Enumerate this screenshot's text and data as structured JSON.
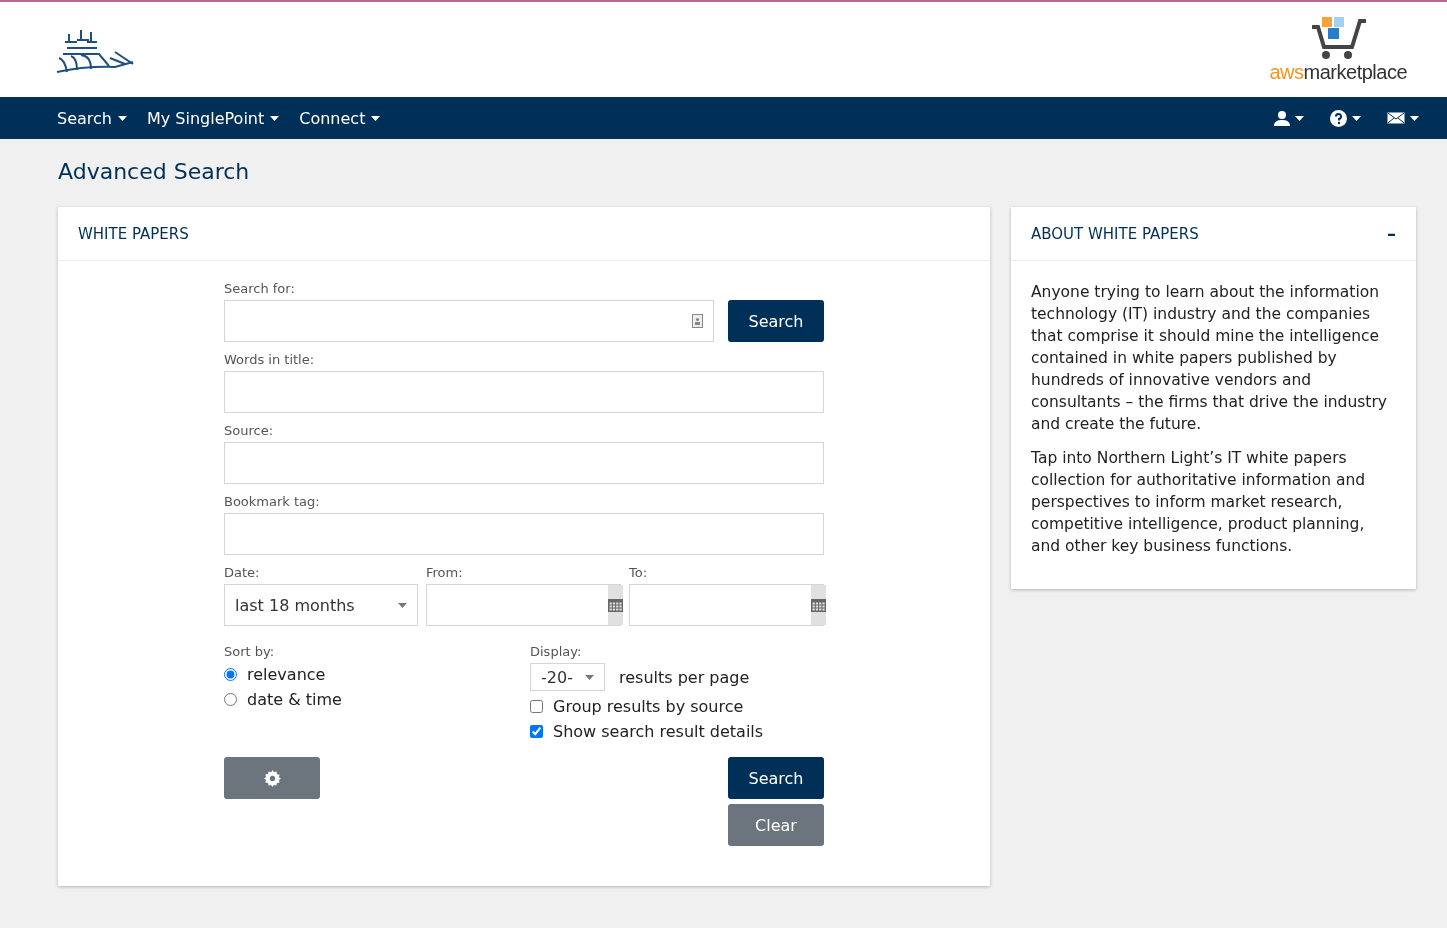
{
  "header": {
    "aws_logo": {
      "prefix": "aws",
      "suffix": "marketplace"
    }
  },
  "nav": {
    "items": [
      {
        "label": "Search"
      },
      {
        "label": "My SinglePoint"
      },
      {
        "label": "Connect"
      }
    ]
  },
  "page_title": "Advanced Search",
  "form_panel": {
    "title": "WHITE PAPERS",
    "search_for": {
      "label": "Search for:",
      "button": "Search"
    },
    "fields": [
      {
        "label": "Words in title:"
      },
      {
        "label": "Source:"
      },
      {
        "label": "Bookmark tag:"
      }
    ],
    "date": {
      "label": "Date:",
      "value": "last 18 months"
    },
    "from": {
      "label": "From:"
    },
    "to": {
      "label": "To:"
    },
    "sort": {
      "label": "Sort by:",
      "options": [
        {
          "label": "relevance",
          "selected": true
        },
        {
          "label": "date & time",
          "selected": false
        }
      ]
    },
    "display": {
      "label": "Display:",
      "value": "-20-",
      "suffix": "results per page"
    },
    "checks": [
      {
        "label": "Group results by source",
        "checked": false
      },
      {
        "label": "Show search result details",
        "checked": true
      }
    ],
    "search_button": "Search",
    "clear_button": "Clear"
  },
  "about_panel": {
    "title": "ABOUT WHITE PAPERS",
    "collapse": "–",
    "paragraphs": [
      "Anyone trying to learn about the information technology (IT) industry and the companies that comprise it should mine the intelligence contained in white papers published by hundreds of innovative vendors and consultants – the firms that drive the industry and create the future.",
      "Tap into Northern Light’s IT white papers collection for authoritative information and perspectives to inform market research, competitive intelligence, product planning, and other key business functions."
    ]
  }
}
